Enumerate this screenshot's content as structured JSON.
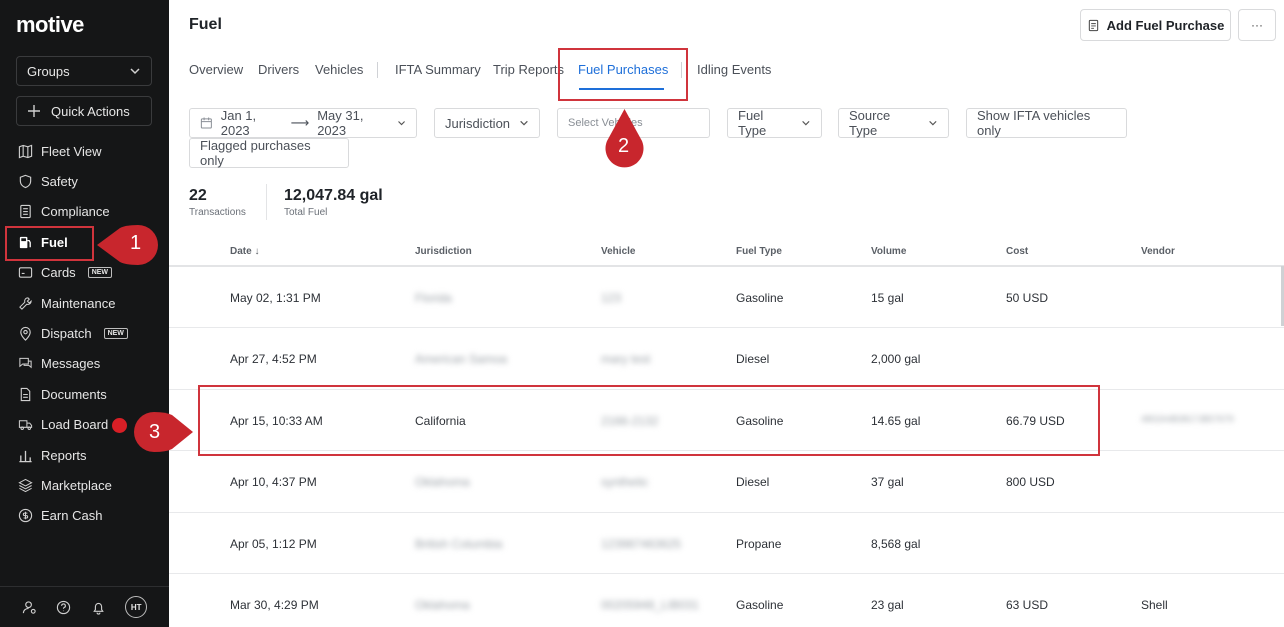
{
  "sidebar": {
    "logo": "motive",
    "groups_label": "Groups",
    "quick_actions_label": "Quick Actions",
    "items": [
      {
        "label": "Fleet View",
        "icon": "map-icon"
      },
      {
        "label": "Safety",
        "icon": "shield-icon"
      },
      {
        "label": "Compliance",
        "icon": "document-list-icon"
      },
      {
        "label": "Fuel",
        "icon": "fuel-pump-icon",
        "active": true
      },
      {
        "label": "Cards",
        "icon": "card-icon",
        "badge": "NEW"
      },
      {
        "label": "Maintenance",
        "icon": "wrench-icon"
      },
      {
        "label": "Dispatch",
        "icon": "location-pin-icon",
        "badge": "NEW"
      },
      {
        "label": "Messages",
        "icon": "messages-icon"
      },
      {
        "label": "Documents",
        "icon": "document-icon"
      },
      {
        "label": "Load Board",
        "icon": "truck-icon"
      },
      {
        "label": "Reports",
        "icon": "bar-chart-icon"
      },
      {
        "label": "Marketplace",
        "icon": "layers-icon"
      },
      {
        "label": "Earn Cash",
        "icon": "dollar-circle-icon"
      }
    ],
    "avatar_initials": "HT"
  },
  "header": {
    "title": "Fuel",
    "add_button_label": "Add Fuel Purchase",
    "more_label": "···"
  },
  "tabs": [
    "Overview",
    "Drivers",
    "Vehicles",
    "IFTA Summary",
    "Trip Reports",
    "Fuel Purchases",
    "Idling Events"
  ],
  "active_tab": "Fuel Purchases",
  "filters": {
    "date_start": "Jan 1, 2023",
    "date_end": "May 31, 2023",
    "jurisdiction": "Jurisdiction",
    "vehicles_placeholder": "Select Vehicles",
    "fuel_type": "Fuel Type",
    "source_type": "Source Type",
    "ifta_toggle": "Show IFTA vehicles only",
    "flagged": "Flagged purchases only"
  },
  "stats": {
    "transactions_value": "22",
    "transactions_label": "Transactions",
    "total_fuel_value": "12,047.84 gal",
    "total_fuel_label": "Total Fuel"
  },
  "table": {
    "columns": [
      "Date ↓",
      "Jurisdiction",
      "Vehicle",
      "Fuel Type",
      "Volume",
      "Cost",
      "Vendor"
    ],
    "rows": [
      {
        "date": "May 02, 1:31 PM",
        "jurisdiction": "Florida",
        "vehicle": "123",
        "fuel_type": "Gasoline",
        "volume": "15 gal",
        "cost": "50 USD",
        "vendor": ""
      },
      {
        "date": "Apr 27, 4:52 PM",
        "jurisdiction": "American Samoa",
        "vehicle": "mary test",
        "fuel_type": "Diesel",
        "volume": "2,000 gal",
        "cost": "",
        "vendor": ""
      },
      {
        "date": "Apr 15, 10:33 AM",
        "jurisdiction": "California",
        "vehicle": "2166-2132",
        "fuel_type": "Gasoline",
        "volume": "14.65 gal",
        "cost": "66.79 USD",
        "vendor": "4802A4B3817JB57679"
      },
      {
        "date": "Apr 10, 4:37 PM",
        "jurisdiction": "Oklahoma",
        "vehicle": "synthetic",
        "fuel_type": "Diesel",
        "volume": "37 gal",
        "cost": "800 USD",
        "vendor": ""
      },
      {
        "date": "Apr 05, 1:12 PM",
        "jurisdiction": "British Columbia",
        "vehicle": "123987463625",
        "fuel_type": "Propane",
        "volume": "8,568 gal",
        "cost": "",
        "vendor": ""
      },
      {
        "date": "Mar 30, 4:29 PM",
        "jurisdiction": "Oklahoma",
        "vehicle": "00205948_LIB031",
        "fuel_type": "Gasoline",
        "volume": "23 gal",
        "cost": "63 USD",
        "vendor": "Shell"
      }
    ]
  },
  "callouts": [
    "1",
    "2",
    "3"
  ],
  "colors": {
    "sidebar_bg": "#151617",
    "accent": "#1e6fd9",
    "highlight": "#d0343c"
  }
}
